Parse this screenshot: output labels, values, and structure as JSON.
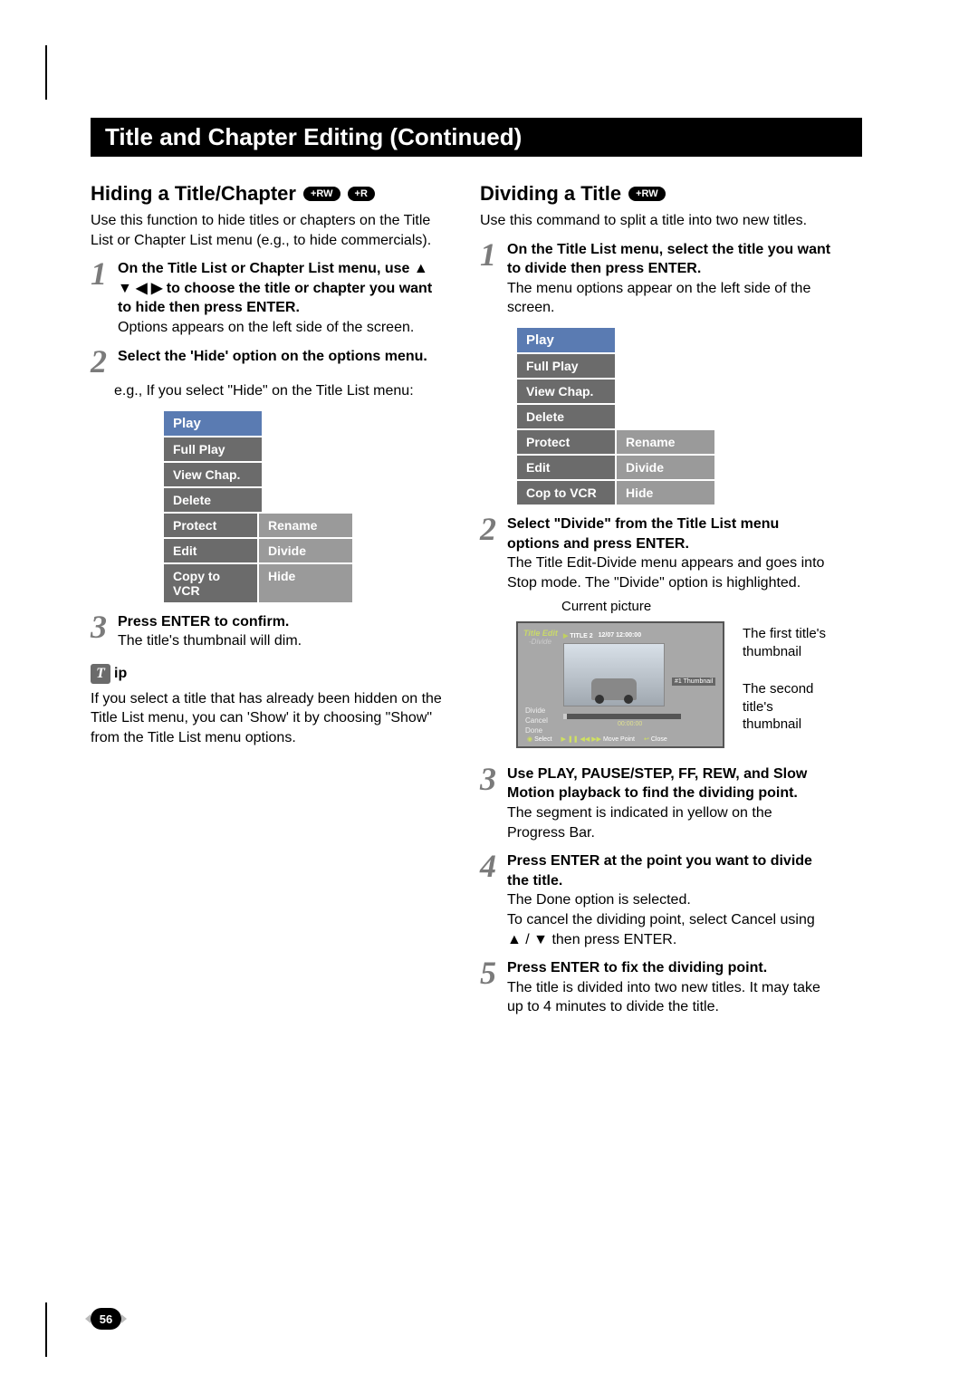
{
  "page_number": "56",
  "title_bar": "Title and Chapter Editing (Continued)",
  "left": {
    "heading": "Hiding a Title/Chapter",
    "badges": [
      "+RW",
      "+R"
    ],
    "intro": "Use this function to hide titles or chapters on the Title List or Chapter List menu (e.g., to hide commercials).",
    "step1_bold": "On the Title List or Chapter List menu, use ▲ ▼ ◀ ▶ to choose the title or chapter you want to hide then press ENTER.",
    "step1_plain": "Options appears on the left side of the screen.",
    "step2_bold": "Select the 'Hide' option on the options menu.",
    "step2_eg": "e.g., If you select \"Hide\" on the Title List menu:",
    "step3_bold": "Press ENTER to confirm.",
    "step3_plain": "The title's thumbnail will dim.",
    "tip_label": "ip",
    "tip_body": "If you select a title that has already been hidden on the Title List menu, you can 'Show' it by choosing \"Show\" from the Title List menu options."
  },
  "right": {
    "heading": "Dividing a Title",
    "badges": [
      "+RW"
    ],
    "intro": "Use this command to split a title into two new titles.",
    "step1_bold": "On the Title List menu, select the title you want to divide then press ENTER.",
    "step1_plain": "The menu options appear on the left side of the screen.",
    "step2_bold": "Select \"Divide\" from the Title List menu options and press ENTER.",
    "step2_plain": "The Title Edit-Divide menu appears and goes into Stop mode. The \"Divide\" option is highlighted.",
    "current_picture_label": "Current picture",
    "annot1": "The first title's thumbnail",
    "annot2": "The second title's thumbnail",
    "step3_bold": "Use PLAY, PAUSE/STEP, FF, REW, and Slow Motion playback to find the dividing point.",
    "step3_plain": "The segment is indicated in yellow on the Progress Bar.",
    "step4_bold": "Press ENTER at the point you want to divide the title.",
    "step4_p1": "The Done option is selected.",
    "step4_p2": "To cancel the dividing point, select Cancel using ▲ / ▼ then press ENTER.",
    "step5_bold": "Press ENTER to fix the dividing point.",
    "step5_plain": "The title is divided into two new titles. It may take up to 4 minutes to divide the title."
  },
  "menu": {
    "header": "Play",
    "left_items": [
      "Full Play",
      "View Chap.",
      "Delete",
      "Protect",
      "Edit",
      "Copy to VCR"
    ],
    "right_items": [
      "Rename",
      "Divide",
      "Hide"
    ]
  },
  "menu2": {
    "header": "Play",
    "left_items": [
      "Full Play",
      "View Chap.",
      "Delete",
      "Protect",
      "Edit",
      "Cop to VCR"
    ],
    "right_items": [
      "Rename",
      "Divide",
      "Hide"
    ]
  },
  "divide_screen": {
    "title": "Title Edit",
    "sub": "-Divide",
    "hdr1": "TITLE 2",
    "hdr2": "12/07    12:00:00",
    "thumb_label": "#1 Thumbnail",
    "side": [
      "Divide",
      "Cancel",
      "Done"
    ],
    "time": "00:00:00",
    "footer_select": "Select",
    "footer_move": "Move Point",
    "footer_close": "Close"
  }
}
